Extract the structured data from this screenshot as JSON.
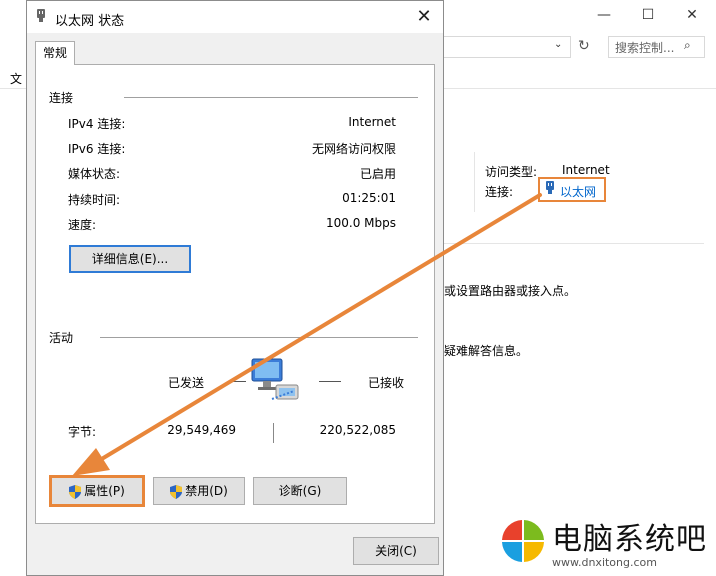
{
  "background_window": {
    "menu_label": "文",
    "search_placeholder": "搜索控制...",
    "access_type_label": "访问类型:",
    "access_type_value": "Internet",
    "connection_label": "连接:",
    "connection_value": "以太网",
    "info_line_1": "或设置路由器或接入点。",
    "info_line_2": "疑难解答信息。"
  },
  "dialog": {
    "title": "以太网 状态",
    "tab_general": "常规",
    "connection_section": "连接",
    "rows": [
      {
        "label": "IPv4 连接:",
        "value": "Internet"
      },
      {
        "label": "IPv6 连接:",
        "value": "无网络访问权限"
      },
      {
        "label": "媒体状态:",
        "value": "已启用"
      },
      {
        "label": "持续时间:",
        "value": "01:25:01"
      },
      {
        "label": "速度:",
        "value": "100.0 Mbps"
      }
    ],
    "details_button": "详细信息(E)...",
    "activity_section": "活动",
    "sent_label": "已发送",
    "received_label": "已接收",
    "bytes_label": "字节:",
    "bytes_sent": "29,549,469",
    "bytes_received": "220,522,085",
    "properties_button": "属性(P)",
    "disable_button": "禁用(D)",
    "diagnose_button": "诊断(G)",
    "close_button": "关闭(C)"
  },
  "watermark": {
    "title": "电脑系统吧",
    "url": "www.dnxitong.com"
  },
  "colors": {
    "highlight_orange": "#e8863a",
    "link_blue": "#0066cc",
    "dialog_bg": "#f0f0f0"
  },
  "icons": [
    "network-adapter-icon",
    "close-icon",
    "shield-icon",
    "network-computers-icon",
    "search-icon",
    "refresh-icon",
    "minimize-icon",
    "maximize-icon"
  ]
}
